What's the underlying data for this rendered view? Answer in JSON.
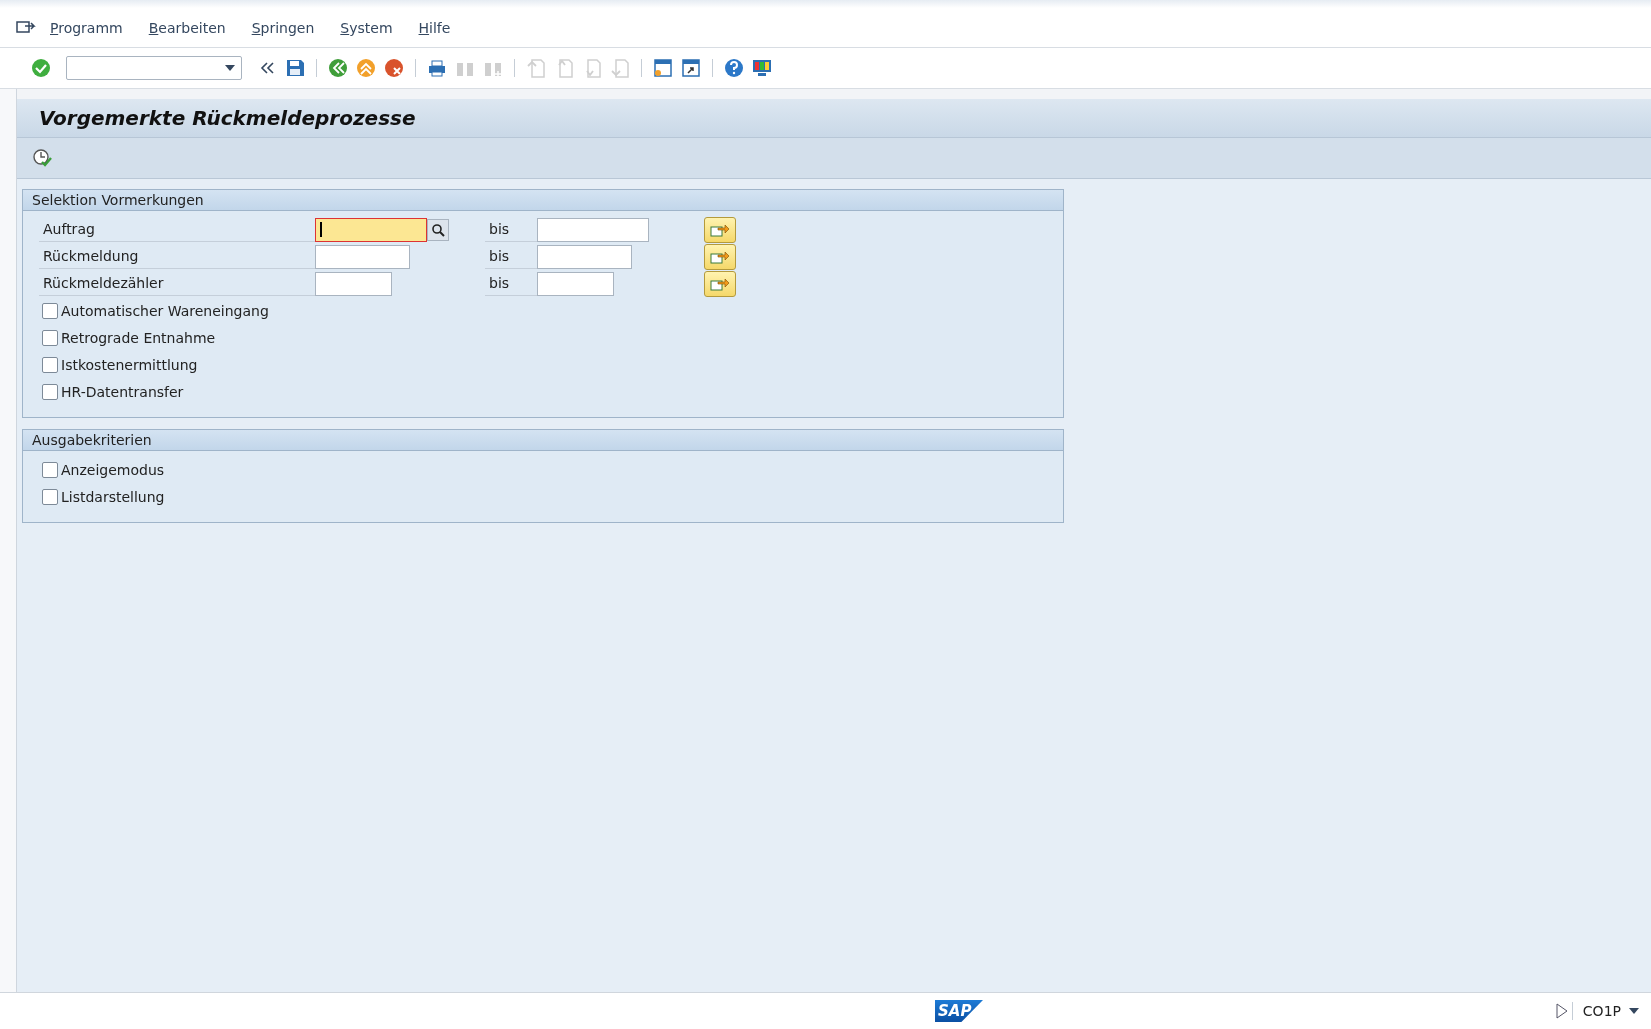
{
  "menu": [
    {
      "label": "Programm"
    },
    {
      "label": "Bearbeiten"
    },
    {
      "label": "Springen"
    },
    {
      "label": "System"
    },
    {
      "label": "Hilfe"
    }
  ],
  "title": "Vorgemerkte Rückmeldeprozesse",
  "groups": [
    {
      "title": "Selektion Vormerkungen",
      "ranges": [
        {
          "label": "Auftrag",
          "to_label": "bis",
          "focused": true
        },
        {
          "label": "Rückmeldung",
          "to_label": "bis",
          "focused": false
        },
        {
          "label": "Rückmeldezähler",
          "to_label": "bis",
          "focused": false
        }
      ],
      "checkboxes": [
        {
          "label": "Automatischer Wareneingang",
          "checked": false
        },
        {
          "label": "Retrograde Entnahme",
          "checked": false
        },
        {
          "label": "Istkostenermittlung",
          "checked": false
        },
        {
          "label": "HR-Datentransfer",
          "checked": false
        }
      ]
    },
    {
      "title": "Ausgabekriterien",
      "checkboxes": [
        {
          "label": "Anzeigemodus",
          "checked": false
        },
        {
          "label": "Listdarstellung",
          "checked": false
        }
      ]
    }
  ],
  "status_bar": {
    "logo": "SAP",
    "system": "CO1P"
  }
}
